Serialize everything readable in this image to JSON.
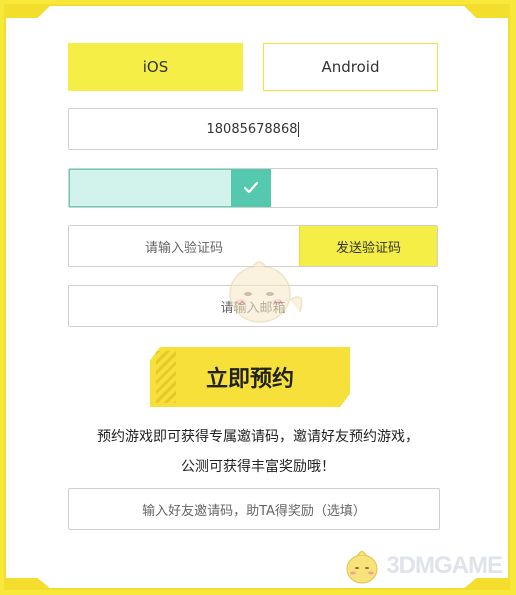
{
  "tabs": [
    {
      "label": "iOS",
      "active": true
    },
    {
      "label": "Android",
      "active": false
    }
  ],
  "phone": {
    "value": "18085678868"
  },
  "slider": {
    "verified_fraction": 0.55,
    "handle_icon": "check-icon",
    "accent": "#55c8b0"
  },
  "code": {
    "placeholder": "请输入验证码",
    "send_label": "发送验证码"
  },
  "email": {
    "placeholder": "请输入邮箱"
  },
  "cta": {
    "label": "立即预约"
  },
  "promo": {
    "line1": "预约游戏即可获得专属邀请码，邀请好友预约游戏，",
    "line2": "公测可获得丰富奖励哦！"
  },
  "invite": {
    "placeholder": "输入好友邀请码，助TA得奖励（选填）"
  },
  "watermark": {
    "text": "3DMGAME"
  },
  "colors": {
    "accent_yellow": "#f4ee46",
    "frame_yellow": "#f3de2e"
  }
}
